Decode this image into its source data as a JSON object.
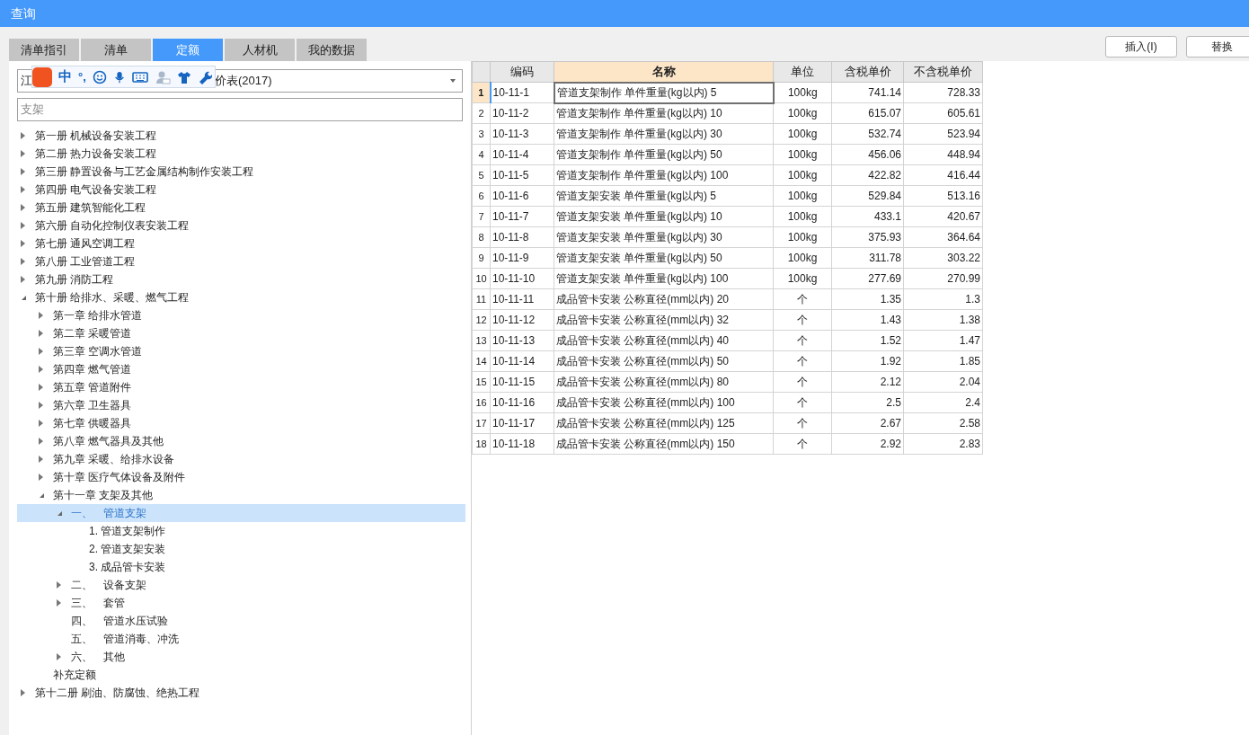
{
  "window": {
    "title": "查询"
  },
  "tabs": [
    {
      "label": "清单指引",
      "selected": false
    },
    {
      "label": "清单",
      "selected": false
    },
    {
      "label": "定额",
      "selected": true
    },
    {
      "label": "人材机",
      "selected": false
    },
    {
      "label": "我的数据",
      "selected": false
    }
  ],
  "buttons": [
    "插入(I)",
    "替换"
  ],
  "library_dropdown": {
    "value_start": "江",
    "value_end": "价表(2017)"
  },
  "ime_toolbar": {
    "mode": "中",
    "punctuation": "°,"
  },
  "search": {
    "value": "支架"
  },
  "tree": [
    {
      "label": "第一册 机械设备安装工程",
      "expanded": false,
      "selected": false
    },
    {
      "label": "第二册 热力设备安装工程",
      "expanded": false,
      "selected": false
    },
    {
      "label": "第三册 静置设备与工艺金属结构制作安装工程",
      "expanded": false,
      "selected": false
    },
    {
      "label": "第四册 电气设备安装工程",
      "expanded": false,
      "selected": false
    },
    {
      "label": "第五册 建筑智能化工程",
      "expanded": false,
      "selected": false
    },
    {
      "label": "第六册 自动化控制仪表安装工程",
      "expanded": false,
      "selected": false
    },
    {
      "label": "第七册 通风空调工程",
      "expanded": false,
      "selected": false
    },
    {
      "label": "第八册 工业管道工程",
      "expanded": false,
      "selected": false
    },
    {
      "label": "第九册 消防工程",
      "expanded": false,
      "selected": false
    },
    {
      "label": "第十册 给排水、采暖、燃气工程",
      "expanded": true,
      "selected": false,
      "children": [
        {
          "label": "第一章 给排水管道",
          "expanded": false,
          "selected": false
        },
        {
          "label": "第二章 采暖管道",
          "expanded": false,
          "selected": false
        },
        {
          "label": "第三章 空调水管道",
          "expanded": false,
          "selected": false
        },
        {
          "label": "第四章 燃气管道",
          "expanded": false,
          "selected": false
        },
        {
          "label": "第五章 管道附件",
          "expanded": false,
          "selected": false
        },
        {
          "label": "第六章 卫生器具",
          "expanded": false,
          "selected": false
        },
        {
          "label": "第七章 供暖器具",
          "expanded": false,
          "selected": false
        },
        {
          "label": "第八章 燃气器具及其他",
          "expanded": false,
          "selected": false
        },
        {
          "label": "第九章 采暖、给排水设备",
          "expanded": false,
          "selected": false
        },
        {
          "label": "第十章 医疗气体设备及附件",
          "expanded": false,
          "selected": false
        },
        {
          "label": "第十一章 支架及其他",
          "expanded": true,
          "selected": false,
          "children": [
            {
              "label": "一、　管道支架",
              "expanded": true,
              "selected": true,
              "children": [
                {
                  "label": "1. 管道支架制作",
                  "selected": false
                },
                {
                  "label": "2. 管道支架安装",
                  "selected": false
                },
                {
                  "label": "3. 成品管卡安装",
                  "selected": false
                }
              ]
            },
            {
              "label": "二、　设备支架",
              "expanded": false,
              "selected": false
            },
            {
              "label": "三、　套管",
              "expanded": false,
              "selected": false
            },
            {
              "label": "四、　管道水压试验",
              "selected": false
            },
            {
              "label": "五、　管道消毒、冲洗",
              "selected": false
            },
            {
              "label": "六、　其他",
              "expanded": false,
              "selected": false
            }
          ]
        },
        {
          "label": "补充定额",
          "selected": false
        }
      ]
    },
    {
      "label": "第十二册 刷油、防腐蚀、绝热工程",
      "expanded": false,
      "selected": false
    }
  ],
  "table": {
    "columns": [
      {
        "label": "编码",
        "selected": false
      },
      {
        "label": "名称",
        "selected": true
      },
      {
        "label": "单位",
        "selected": false
      },
      {
        "label": "含税单价",
        "selected": false
      },
      {
        "label": "不含税单价",
        "selected": false
      }
    ],
    "rows": [
      {
        "index": "1",
        "selected": true,
        "cells": [
          "10-11-1",
          "管道支架制作 单件重量(kg以内) 5",
          "100kg",
          "741.14",
          "728.33"
        ]
      },
      {
        "index": "2",
        "selected": false,
        "cells": [
          "10-11-2",
          "管道支架制作 单件重量(kg以内) 10",
          "100kg",
          "615.07",
          "605.61"
        ]
      },
      {
        "index": "3",
        "selected": false,
        "cells": [
          "10-11-3",
          "管道支架制作 单件重量(kg以内) 30",
          "100kg",
          "532.74",
          "523.94"
        ]
      },
      {
        "index": "4",
        "selected": false,
        "cells": [
          "10-11-4",
          "管道支架制作 单件重量(kg以内) 50",
          "100kg",
          "456.06",
          "448.94"
        ]
      },
      {
        "index": "5",
        "selected": false,
        "cells": [
          "10-11-5",
          "管道支架制作 单件重量(kg以内) 100",
          "100kg",
          "422.82",
          "416.44"
        ]
      },
      {
        "index": "6",
        "selected": false,
        "cells": [
          "10-11-6",
          "管道支架安装 单件重量(kg以内) 5",
          "100kg",
          "529.84",
          "513.16"
        ]
      },
      {
        "index": "7",
        "selected": false,
        "cells": [
          "10-11-7",
          "管道支架安装 单件重量(kg以内) 10",
          "100kg",
          "433.1",
          "420.67"
        ]
      },
      {
        "index": "8",
        "selected": false,
        "cells": [
          "10-11-8",
          "管道支架安装 单件重量(kg以内) 30",
          "100kg",
          "375.93",
          "364.64"
        ]
      },
      {
        "index": "9",
        "selected": false,
        "cells": [
          "10-11-9",
          "管道支架安装 单件重量(kg以内) 50",
          "100kg",
          "311.78",
          "303.22"
        ]
      },
      {
        "index": "10",
        "selected": false,
        "cells": [
          "10-11-10",
          "管道支架安装 单件重量(kg以内) 100",
          "100kg",
          "277.69",
          "270.99"
        ]
      },
      {
        "index": "11",
        "selected": false,
        "cells": [
          "10-11-11",
          "成品管卡安装 公称直径(mm以内) 20",
          "个",
          "1.35",
          "1.3"
        ]
      },
      {
        "index": "12",
        "selected": false,
        "cells": [
          "10-11-12",
          "成品管卡安装 公称直径(mm以内) 32",
          "个",
          "1.43",
          "1.38"
        ]
      },
      {
        "index": "13",
        "selected": false,
        "cells": [
          "10-11-13",
          "成品管卡安装 公称直径(mm以内) 40",
          "个",
          "1.52",
          "1.47"
        ]
      },
      {
        "index": "14",
        "selected": false,
        "cells": [
          "10-11-14",
          "成品管卡安装 公称直径(mm以内) 50",
          "个",
          "1.92",
          "1.85"
        ]
      },
      {
        "index": "15",
        "selected": false,
        "cells": [
          "10-11-15",
          "成品管卡安装 公称直径(mm以内) 80",
          "个",
          "2.12",
          "2.04"
        ]
      },
      {
        "index": "16",
        "selected": false,
        "cells": [
          "10-11-16",
          "成品管卡安装 公称直径(mm以内) 100",
          "个",
          "2.5",
          "2.4"
        ]
      },
      {
        "index": "17",
        "selected": false,
        "cells": [
          "10-11-17",
          "成品管卡安装 公称直径(mm以内) 125",
          "个",
          "2.67",
          "2.58"
        ]
      },
      {
        "index": "18",
        "selected": false,
        "cells": [
          "10-11-18",
          "成品管卡安装 公称直径(mm以内) 150",
          "个",
          "2.92",
          "2.83"
        ]
      }
    ]
  }
}
